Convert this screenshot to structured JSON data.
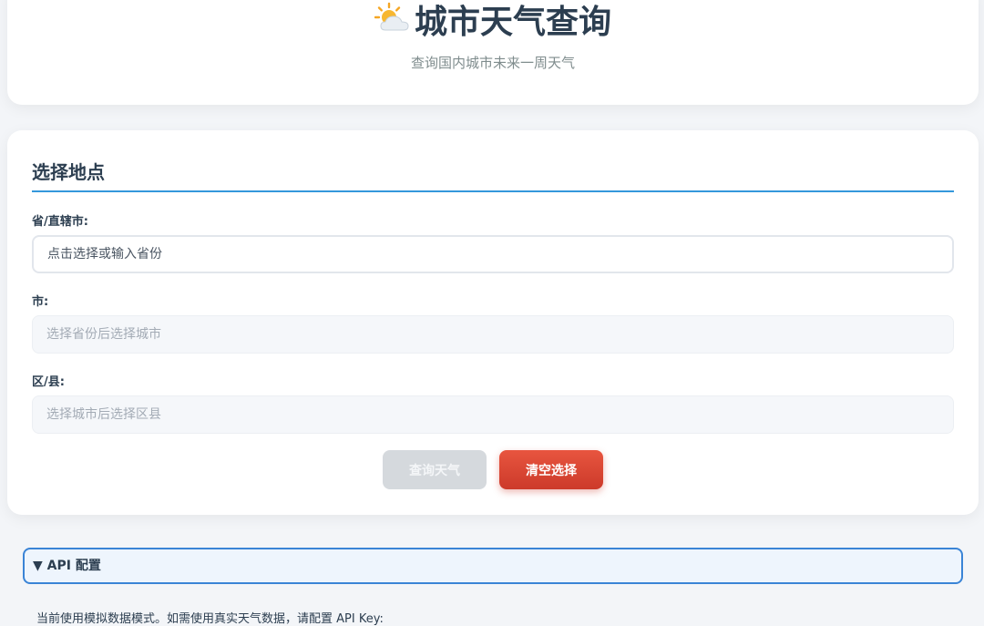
{
  "header": {
    "icon": "sun-behind-cloud-icon",
    "title": "城市天气查询",
    "subtitle": "查询国内城市未来一周天气"
  },
  "location": {
    "section_title": "选择地点",
    "province": {
      "label": "省/直辖市:",
      "placeholder": "点击选择或输入省份"
    },
    "city": {
      "label": "市:",
      "placeholder": "选择省份后选择城市"
    },
    "district": {
      "label": "区/县:",
      "placeholder": "选择城市后选择区县"
    },
    "query_button": "查询天气",
    "clear_button": "清空选择"
  },
  "api": {
    "toggle_label": "▼ API 配置",
    "note": "当前使用模拟数据模式。如需使用真实天气数据，请配置 API Key:"
  },
  "colors": {
    "accent": "#3498db",
    "clear_button": "#d9432f",
    "disabled_button": "#d5d9dd"
  }
}
